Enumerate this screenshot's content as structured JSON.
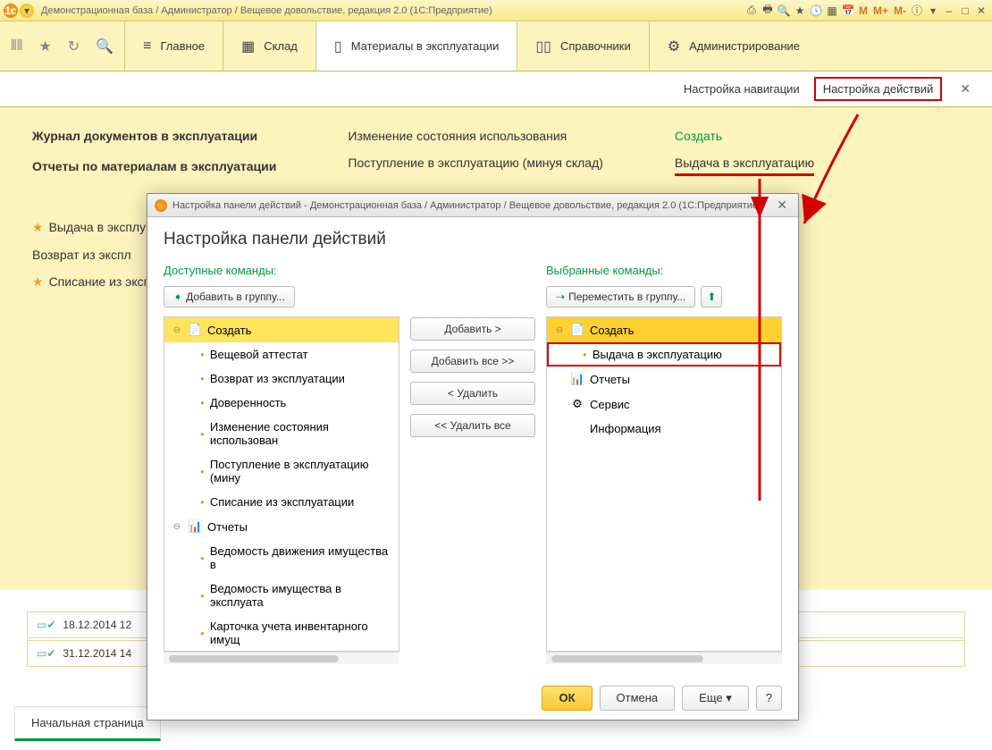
{
  "titlebar": {
    "text": "Демонстрационная база / Администратор / Вещевое довольствие, редакция 2.0  (1С:Предприятие)",
    "m": "M",
    "mp": "M+",
    "mm": "M-"
  },
  "nav": {
    "main": "Главное",
    "warehouse": "Склад",
    "materials": "Материалы в эксплуатации",
    "catalogs": "Справочники",
    "admin": "Администрирование"
  },
  "sub": {
    "nav_settings": "Настройка навигации",
    "action_settings": "Настройка действий"
  },
  "content": {
    "col1": {
      "h1": "Журнал документов в эксплуатации",
      "h2": "Отчеты по материалам в эксплуатации",
      "l1": "Выдача в эксплу",
      "l2": "Возврат из экспл",
      "l3": "Списание из эксп"
    },
    "col2": {
      "l1": "Изменение состояния использования",
      "l2": "Поступление в эксплуатацию (минуя склад)"
    },
    "col3": {
      "h": "Создать",
      "l1": "Выдача в эксплуатацию"
    }
  },
  "dialog": {
    "title": "Настройка панели действий - Демонстрационная база / Администратор / Вещевое довольствие, редакция 2.0  (1С:Предприятие)",
    "heading": "Настройка панели действий",
    "available": "Доступные команды:",
    "selected": "Выбранные команды:",
    "add_to_group": "Добавить в группу...",
    "move_to_group": "Переместить в группу...",
    "add": "Добавить >",
    "add_all": "Добавить все >>",
    "remove": "< Удалить",
    "remove_all": "<< Удалить все",
    "ok": "ОК",
    "cancel": "Отмена",
    "more": "Еще",
    "help": "?",
    "left_tree": {
      "create": "Создать",
      "i1": "Вещевой аттестат",
      "i2": "Возврат из эксплуатации",
      "i3": "Доверенность",
      "i4": "Изменение состояния использован",
      "i5": "Поступление в эксплуатацию (мину",
      "i6": "Списание из эксплуатации",
      "reports": "Отчеты",
      "r1": "Ведомость движения имущества в",
      "r2": "Ведомость имущества в эксплуата",
      "r3": "Карточка учета инвентарного имущ"
    },
    "right_tree": {
      "create": "Создать",
      "i1": "Выдача в эксплуатацию",
      "reports": "Отчеты",
      "service": "Сервис",
      "info": "Информация"
    }
  },
  "bottom_rows": {
    "r1": "18.12.2014 12",
    "r2": "31.12.2014 14"
  },
  "bottom_tab": "Начальная страница"
}
